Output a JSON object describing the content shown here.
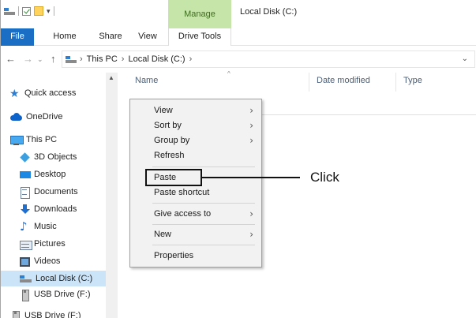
{
  "quick_access_toolbar": {
    "icons": [
      "drive-icon",
      "properties-check-icon",
      "new-folder-icon",
      "customize-arrow-icon"
    ],
    "arrow_glyph": "▾"
  },
  "ribbon": {
    "contextual_group": "Manage",
    "window_title": "Local Disk (C:)",
    "tabs": [
      {
        "label": "File",
        "selected": true
      },
      {
        "label": "Home"
      },
      {
        "label": "Share"
      },
      {
        "label": "View"
      },
      {
        "label": "Drive Tools"
      }
    ]
  },
  "address_bar": {
    "back_glyph": "←",
    "forward_glyph": "→",
    "recent_glyph": "⌄",
    "up_glyph": "↑",
    "crumbs": [
      "›",
      "This PC",
      "›",
      "Local Disk (C:)",
      "›"
    ],
    "dropdown_glyph": "⌄"
  },
  "nav_pane": {
    "items": [
      {
        "label": "Quick access",
        "icon": "star-icon"
      },
      {
        "label": "OneDrive",
        "icon": "cloud-icon"
      },
      {
        "label": "This PC",
        "icon": "computer-icon"
      },
      {
        "label": "3D Objects",
        "icon": "3d-objects-icon"
      },
      {
        "label": "Desktop",
        "icon": "desktop-icon"
      },
      {
        "label": "Documents",
        "icon": "documents-icon"
      },
      {
        "label": "Downloads",
        "icon": "downloads-icon"
      },
      {
        "label": "Music",
        "icon": "music-icon"
      },
      {
        "label": "Pictures",
        "icon": "pictures-icon"
      },
      {
        "label": "Videos",
        "icon": "videos-icon"
      },
      {
        "label": "Local Disk (C:)",
        "icon": "local-disk-icon",
        "selected": true
      },
      {
        "label": "USB Drive (F:)",
        "icon": "usb-drive-icon"
      },
      {
        "label": "USB Drive (F:)",
        "icon": "usb-drive-icon"
      }
    ]
  },
  "file_list": {
    "columns": [
      "Name",
      "Date modified",
      "Type"
    ],
    "sort_glyph": "^"
  },
  "context_menu": {
    "items": [
      {
        "label": "View",
        "submenu": true
      },
      {
        "label": "Sort by",
        "submenu": true
      },
      {
        "label": "Group by",
        "submenu": true
      },
      {
        "label": "Refresh"
      },
      {
        "label": "Paste",
        "highlighted_by_annotation": true
      },
      {
        "label": "Paste shortcut"
      },
      {
        "label": "Give access to",
        "submenu": true
      },
      {
        "label": "New",
        "submenu": true
      },
      {
        "label": "Properties"
      }
    ],
    "submenu_glyph": "›"
  },
  "annotation": {
    "text": "Click"
  }
}
